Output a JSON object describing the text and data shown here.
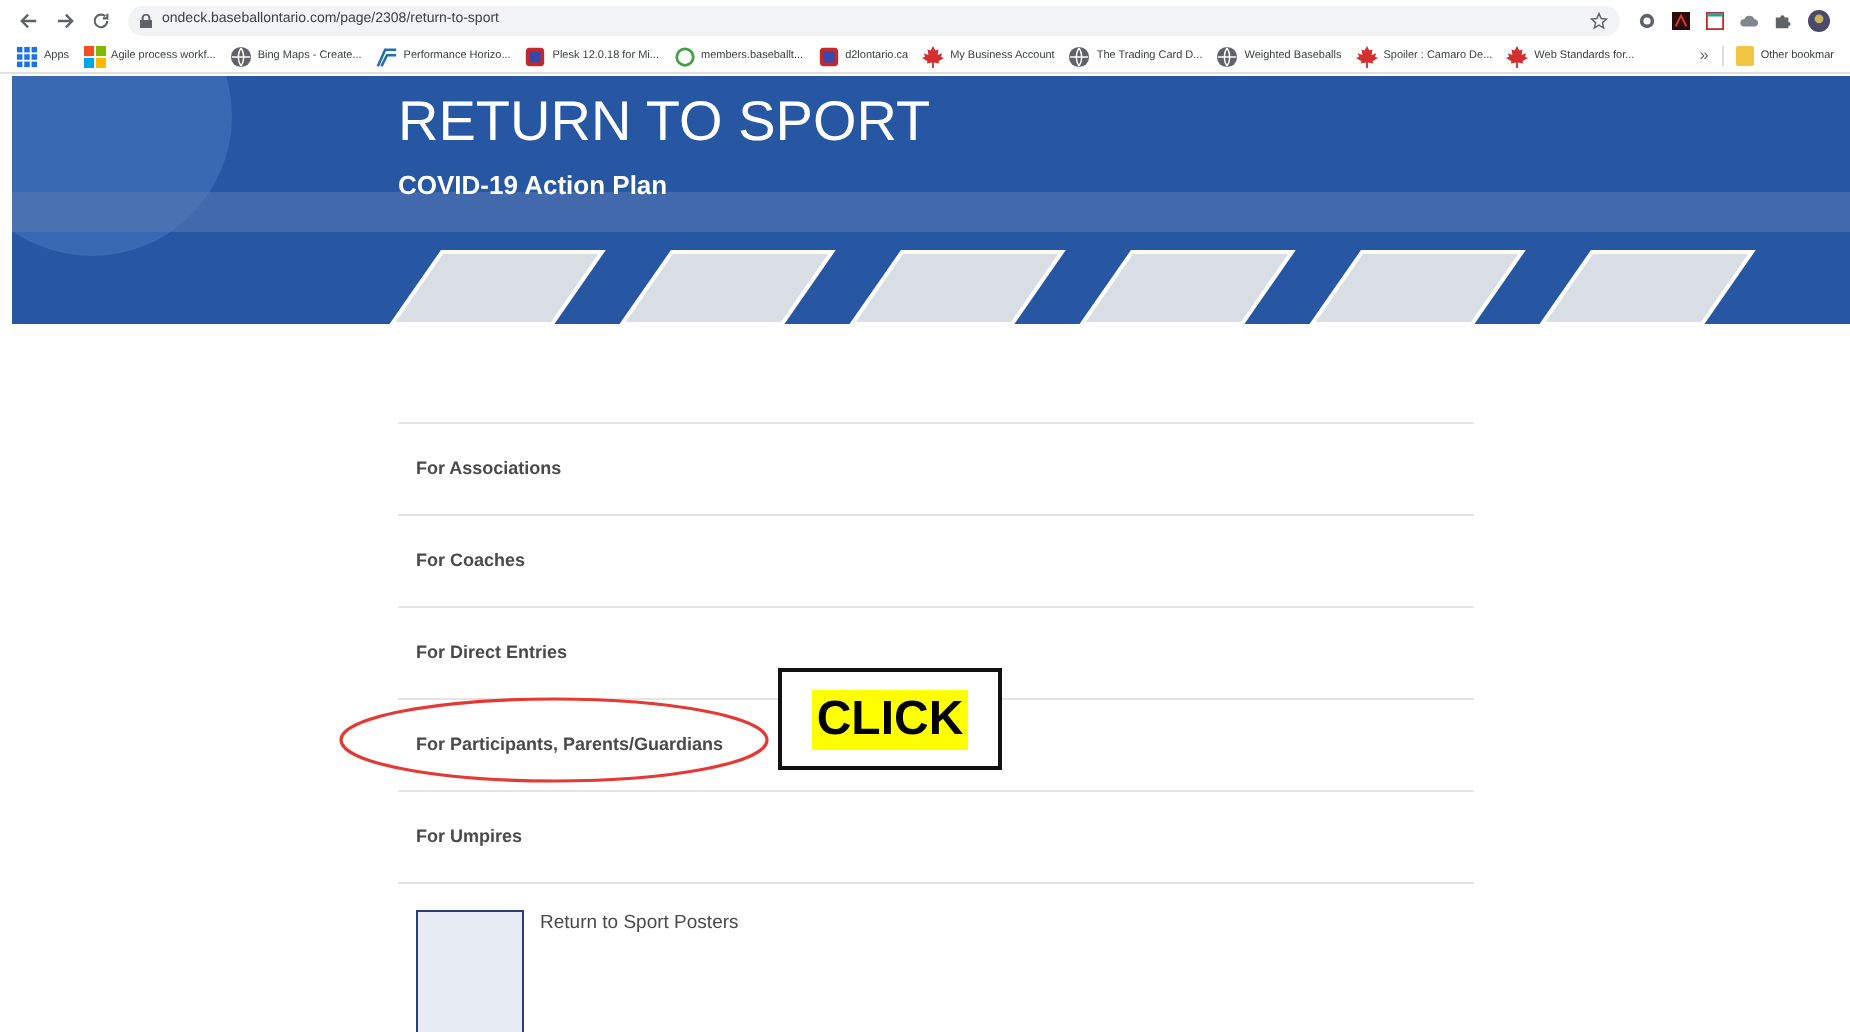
{
  "browser": {
    "url": "ondeck.baseballontario.com/page/2308/return-to-sport",
    "bookmarks": [
      {
        "label": "Apps",
        "kind": "grid"
      },
      {
        "label": "Agile process workf...",
        "kind": "squares"
      },
      {
        "label": "Bing Maps - Create...",
        "kind": "globe"
      },
      {
        "label": "Performance Horizo...",
        "kind": "chart"
      },
      {
        "label": "Plesk 12.0.18 for Mi...",
        "kind": "badge"
      },
      {
        "label": "members.baseballt...",
        "kind": "ring"
      },
      {
        "label": "d2lontario.ca",
        "kind": "badge"
      },
      {
        "label": "My Business Account",
        "kind": "leaf"
      },
      {
        "label": "The Trading Card D...",
        "kind": "globe"
      },
      {
        "label": "Weighted Baseballs",
        "kind": "globe"
      },
      {
        "label": "Spoiler : Camaro De...",
        "kind": "leaf"
      },
      {
        "label": "Web Standards for...",
        "kind": "leaf"
      }
    ],
    "overflow": "»",
    "other": "Other bookmar"
  },
  "banner": {
    "title": "RETURN TO SPORT",
    "subtitle": "COVID-19 Action Plan"
  },
  "sections": [
    {
      "label": "For Associations",
      "circled": false
    },
    {
      "label": "For Coaches",
      "circled": false
    },
    {
      "label": "For Direct Entries",
      "circled": false
    },
    {
      "label": "For Participants, Parents/Guardians",
      "circled": true
    },
    {
      "label": "For Umpires",
      "circled": false
    }
  ],
  "callout": {
    "text": "CLICK"
  },
  "poster": {
    "label": "Return to Sport Posters"
  }
}
